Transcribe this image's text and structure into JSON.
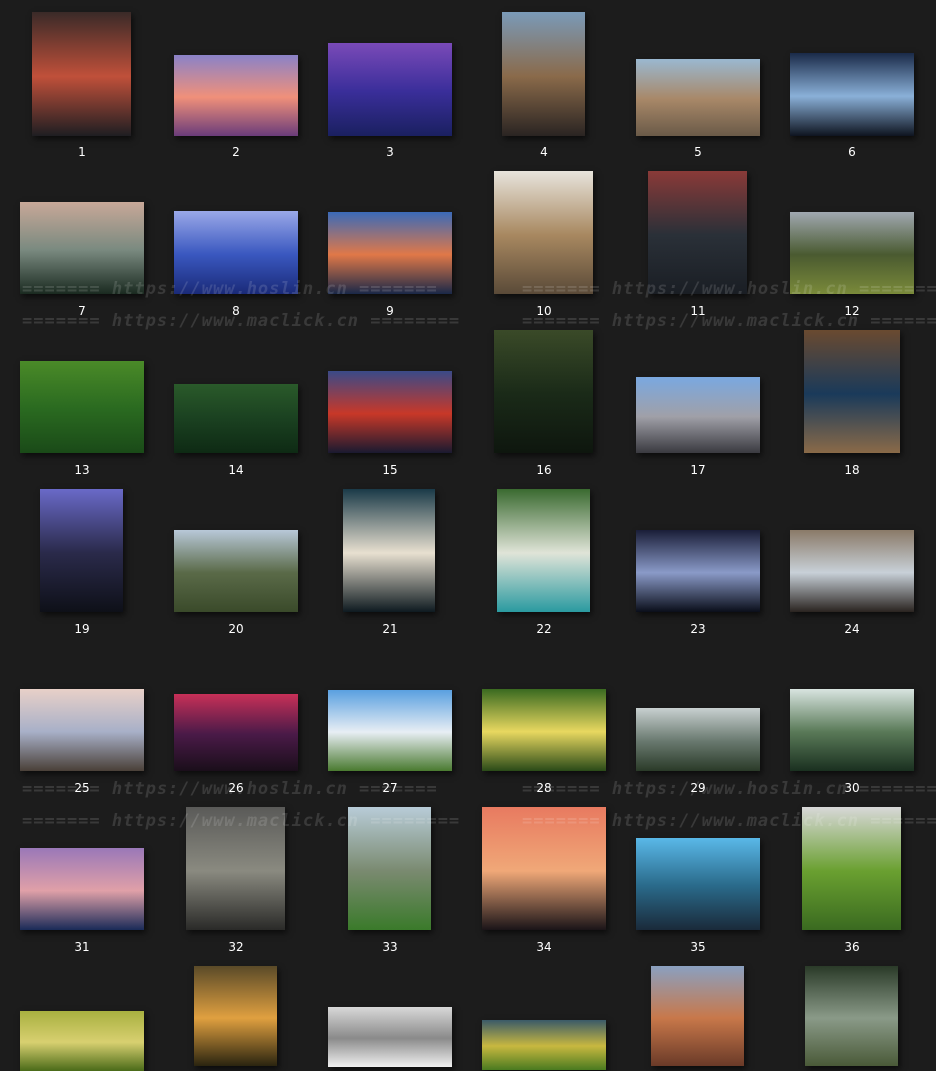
{
  "watermarks": {
    "hoslin": "======= https://www.hoslin.cn =======",
    "maclick": "======= https://www.maclick.cn ========"
  },
  "items": [
    {
      "label": "1",
      "colors": [
        "#3a2a28",
        "#c0503a",
        "#1e1e22"
      ]
    },
    {
      "label": "2",
      "colors": [
        "#8a82c8",
        "#f0907a",
        "#6a3c7a"
      ]
    },
    {
      "label": "3",
      "colors": [
        "#7a4ab8",
        "#3a2e9a",
        "#1a2060"
      ]
    },
    {
      "label": "4",
      "colors": [
        "#7a9ab8",
        "#8a6a4a",
        "#2a2422"
      ]
    },
    {
      "label": "5",
      "colors": [
        "#9ab8d0",
        "#a88868",
        "#6a5a48"
      ]
    },
    {
      "label": "6",
      "colors": [
        "#1a2a48",
        "#8ab0d8",
        "#0e1420"
      ]
    },
    {
      "label": "7",
      "colors": [
        "#c8a898",
        "#7a8a80",
        "#1a2a20"
      ]
    },
    {
      "label": "8",
      "colors": [
        "#9aa8e8",
        "#3a58c0",
        "#1a2a78"
      ]
    },
    {
      "label": "9",
      "colors": [
        "#3a6ab8",
        "#e07848",
        "#1a2848"
      ]
    },
    {
      "label": "10",
      "colors": [
        "#e8e4dc",
        "#a88860",
        "#5a4a38"
      ]
    },
    {
      "label": "11",
      "colors": [
        "#8a3a38",
        "#2a3038",
        "#1a1e24"
      ]
    },
    {
      "label": "12",
      "colors": [
        "#a0a8b0",
        "#4a5a30",
        "#7a8a3a"
      ]
    },
    {
      "label": "13",
      "colors": [
        "#4a8a28",
        "#2a6a20",
        "#1a4a18"
      ]
    },
    {
      "label": "14",
      "colors": [
        "#2a5a2a",
        "#1a4020",
        "#0e2a14"
      ]
    },
    {
      "label": "15",
      "colors": [
        "#3a4a88",
        "#c83828",
        "#1a1a30"
      ]
    },
    {
      "label": "16",
      "colors": [
        "#3a4a28",
        "#1a2a18",
        "#0e160e"
      ]
    },
    {
      "label": "17",
      "colors": [
        "#7aa8e0",
        "#a0a0a8",
        "#3a3a40"
      ]
    },
    {
      "label": "18",
      "colors": [
        "#6a4a30",
        "#1a3a5a",
        "#8a6a48"
      ]
    },
    {
      "label": "19",
      "colors": [
        "#6a6ac8",
        "#2a2a4a",
        "#0e1018"
      ]
    },
    {
      "label": "20",
      "colors": [
        "#b8c8d8",
        "#5a6a48",
        "#3a4a2a"
      ]
    },
    {
      "label": "21",
      "colors": [
        "#1a3a48",
        "#e8e0d0",
        "#0e1a20"
      ]
    },
    {
      "label": "22",
      "colors": [
        "#3a6a30",
        "#e0e4d8",
        "#2a9aa0"
      ]
    },
    {
      "label": "23",
      "colors": [
        "#1a1e38",
        "#8a9ac8",
        "#0a0e1a"
      ]
    },
    {
      "label": "24",
      "colors": [
        "#8a7a68",
        "#c8d0d8",
        "#2a2420"
      ]
    },
    {
      "label": "25",
      "colors": [
        "#e8d0c8",
        "#a8b0c8",
        "#4a4038"
      ]
    },
    {
      "label": "26",
      "colors": [
        "#c83058",
        "#4a1a48",
        "#1a0e1a"
      ]
    },
    {
      "label": "27",
      "colors": [
        "#5aa0e0",
        "#e8eef4",
        "#4a7a30"
      ]
    },
    {
      "label": "28",
      "colors": [
        "#3a6a20",
        "#e8d860",
        "#2a4a18"
      ]
    },
    {
      "label": "29",
      "colors": [
        "#c8d0d0",
        "#6a7a70",
        "#2a3a28"
      ]
    },
    {
      "label": "30",
      "colors": [
        "#d8e4e0",
        "#5a7a58",
        "#1a3020"
      ]
    },
    {
      "label": "31",
      "colors": [
        "#9a78b8",
        "#e0a0a8",
        "#1a2a58"
      ]
    },
    {
      "label": "32",
      "colors": [
        "#5a5a58",
        "#8a8a80",
        "#2a2a28"
      ]
    },
    {
      "label": "33",
      "colors": [
        "#b8ccd8",
        "#7a8a70",
        "#3a7a2a"
      ]
    },
    {
      "label": "34",
      "colors": [
        "#e87a60",
        "#f0a878",
        "#1a1418"
      ]
    },
    {
      "label": "35",
      "colors": [
        "#5ab8e8",
        "#2a6a8a",
        "#1a2a3a"
      ]
    },
    {
      "label": "36",
      "colors": [
        "#d8d8d8",
        "#6aa030",
        "#3a6a20"
      ]
    },
    {
      "label": "",
      "colors": [
        "#a8b040",
        "#d8d070",
        "#4a6a18"
      ]
    },
    {
      "label": "",
      "colors": [
        "#5a4a28",
        "#e0a040",
        "#2a2410"
      ]
    },
    {
      "label": "",
      "colors": [
        "#d8d8d8",
        "#8a8a8a",
        "#f0f0f0"
      ]
    },
    {
      "label": "",
      "colors": [
        "#3a5a68",
        "#c8b840",
        "#4a7a20"
      ]
    },
    {
      "label": "",
      "colors": [
        "#8aa0c0",
        "#c8784a",
        "#6a3a28"
      ]
    },
    {
      "label": "",
      "colors": [
        "#2a3a28",
        "#8a9a88",
        "#4a5a38"
      ]
    }
  ]
}
